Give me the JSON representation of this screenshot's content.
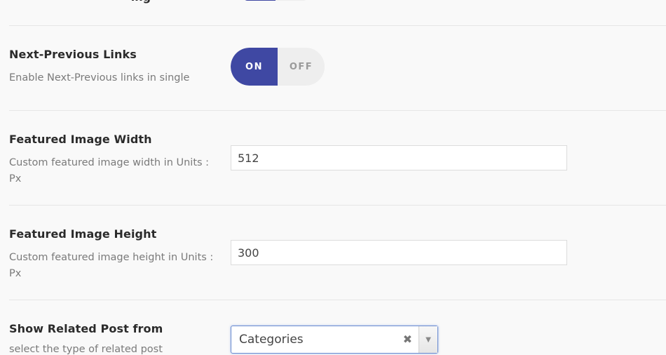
{
  "top": {
    "label": "ing"
  },
  "next_prev": {
    "title": "Next-Previous Links",
    "description": "Enable Next-Previous links in single",
    "on_label": "ON",
    "off_label": "OFF",
    "state": "on"
  },
  "featured_width": {
    "title": "Featured Image Width",
    "description": "Custom featured image width in Units : Px",
    "value": "512"
  },
  "featured_height": {
    "title": "Featured Image Height",
    "description": "Custom featured image height in Units : Px",
    "value": "300"
  },
  "related_post": {
    "title": "Show Related Post from",
    "description": "select the type of related post",
    "selected": "Categories",
    "clear_icon": "clear-icon",
    "arrow_icon": "dropdown-arrow-icon"
  },
  "colors": {
    "accent": "#3f48a3",
    "toggle_off_bg": "#eeeeee",
    "background": "#f9f9f9"
  }
}
